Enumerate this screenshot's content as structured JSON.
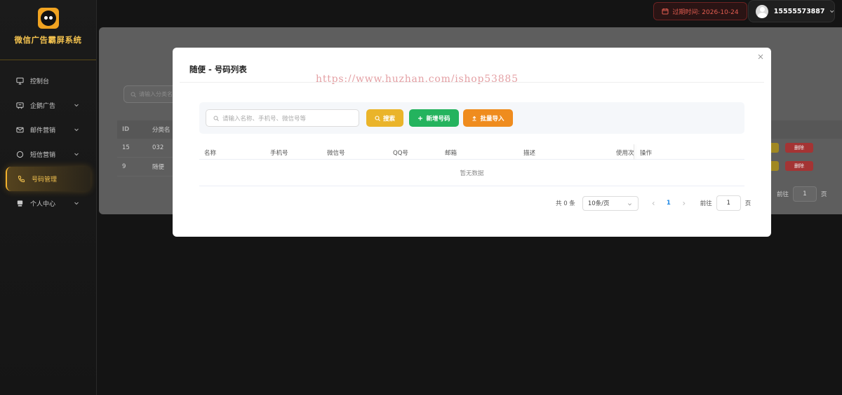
{
  "app": {
    "name": "微信广告霸屏系统"
  },
  "sidebar": {
    "items": [
      {
        "label": "控制台",
        "icon": "monitor-icon",
        "expandable": false,
        "active": false
      },
      {
        "label": "企鹅广告",
        "icon": "ad-icon",
        "expandable": true,
        "active": false
      },
      {
        "label": "邮件营销",
        "icon": "mail-icon",
        "expandable": true,
        "active": false
      },
      {
        "label": "短信营销",
        "icon": "chat-icon",
        "expandable": true,
        "active": false
      },
      {
        "label": "号码管理",
        "icon": "phone-icon",
        "expandable": false,
        "active": true
      },
      {
        "label": "个人中心",
        "icon": "user-card-icon",
        "expandable": true,
        "active": false
      }
    ]
  },
  "header": {
    "expire_text": "过期时间: 2026-10-24",
    "username": "15555573887"
  },
  "background": {
    "search_placeholder": "请输入分类名",
    "columns": [
      "ID",
      "分类名"
    ],
    "rows": [
      {
        "id": "15",
        "name": "032"
      },
      {
        "id": "9",
        "name": "随便"
      }
    ],
    "delete_label": "删除",
    "pager": {
      "goto": "前往",
      "page": "1",
      "page_suffix": "页"
    }
  },
  "modal": {
    "title": "随便 - 号码列表",
    "watermark": "https://www.huzhan.com/ishop53885",
    "search_placeholder": "请输入名称、手机号、微信号等",
    "buttons": {
      "search": "搜索",
      "add": "新增号码",
      "import": "批量导入"
    },
    "columns": [
      "名称",
      "手机号",
      "微信号",
      "QQ号",
      "邮箱",
      "描述",
      "使用次",
      "操作"
    ],
    "empty_text": "暂无数据",
    "pager": {
      "total": "共 0 条",
      "page_size": "10条/页",
      "current_page": "1",
      "goto": "前往",
      "goto_value": "1",
      "page_suffix": "页"
    }
  },
  "colors": {
    "accent": "#f2b12d",
    "search_button": "#eab42a",
    "add_button": "#24b35e",
    "import_button": "#ef8c1e",
    "expire_text": "#e15c50"
  }
}
